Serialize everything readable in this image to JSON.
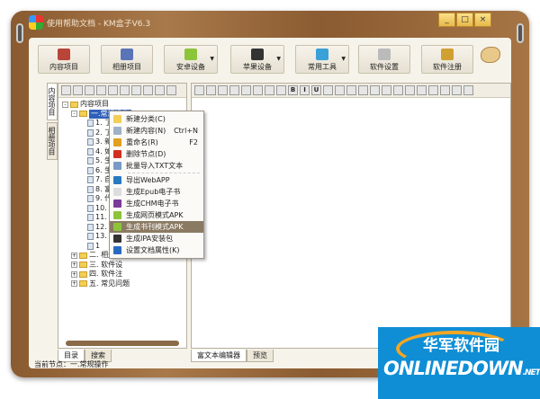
{
  "window": {
    "title": "使用帮助文档 - KM盒子V6.3",
    "minimize": "_",
    "maximize": "□",
    "close": "×"
  },
  "toolbar": [
    {
      "label": "内容项目",
      "icon": "book-icon",
      "color": "#b8443a"
    },
    {
      "label": "相册项目",
      "icon": "photo-icon",
      "color": "#5a74b8"
    },
    {
      "label": "安卓设备",
      "icon": "android-icon",
      "color": "#8cc43a",
      "dropdown": true
    },
    {
      "label": "苹果设备",
      "icon": "apple-icon",
      "color": "#333333",
      "dropdown": true
    },
    {
      "label": "常用工具",
      "icon": "blocks-icon",
      "color": "#3aa0d8",
      "dropdown": true
    },
    {
      "label": "软件设置",
      "icon": "gear-icon",
      "color": "#bbbbbb"
    },
    {
      "label": "软件注册",
      "icon": "key-icon",
      "color": "#d0a030"
    }
  ],
  "vtabs": [
    "内容项目",
    "相册项目"
  ],
  "tree": {
    "root": "内容项目",
    "selected": "一.常规操作",
    "children": [
      "1. 了解",
      "2. 了解",
      "3. 新建",
      "4. 如何",
      "5. 生成",
      "6. 生成",
      "7. 自定",
      "8. 富文",
      "9. 代码",
      "10. 自",
      "11. 如",
      "12. 如",
      "13. 书",
      "1"
    ],
    "folders": [
      "二. 相册项",
      "三. 软件设",
      "四. 软件注",
      "五. 常见问题"
    ]
  },
  "context_menu": [
    {
      "label": "新建分类(C)",
      "icon": "folder-icon",
      "color": "#f2cf55"
    },
    {
      "label": "新建内容(N)",
      "shortcut": "Ctrl+N",
      "icon": "document-icon",
      "color": "#9fb0c8"
    },
    {
      "label": "重命名(R)",
      "shortcut": "F2",
      "icon": "rename-icon",
      "color": "#e0a020"
    },
    {
      "label": "删除节点(D)",
      "icon": "delete-icon",
      "color": "#d03020"
    },
    {
      "label": "批量导入TXT文本",
      "icon": "import-icon",
      "color": "#7a9ac8",
      "sep": true
    },
    {
      "label": "导出WebAPP",
      "icon": "globe-icon",
      "color": "#2a7ac0"
    },
    {
      "label": "生成Epub电子书",
      "icon": "open-book-icon",
      "color": "#dddddd"
    },
    {
      "label": "生成CHM电子书",
      "icon": "chm-book-icon",
      "color": "#7a3a9a"
    },
    {
      "label": "生成网页模式APK",
      "icon": "android-icon",
      "color": "#8cc43a"
    },
    {
      "label": "生成书刊模式APK",
      "icon": "android-icon",
      "color": "#8cc43a",
      "highlighted": true
    },
    {
      "label": "生成IPA安装包",
      "icon": "apple-icon",
      "color": "#333333"
    },
    {
      "label": "设置文档属性(K)",
      "icon": "properties-icon",
      "color": "#2a6ac0"
    }
  ],
  "left_tabs": [
    "目录",
    "搜索"
  ],
  "right_tabs": [
    "富文本编辑器",
    "预览"
  ],
  "editor_toolbar": {
    "bold": "B",
    "italic": "I",
    "underline": "U"
  },
  "status": "当前节点：一.常规操作",
  "watermark": {
    "cn": "华军软件园",
    "en": "ONLINEDOWN",
    "suffix": ".NET"
  }
}
